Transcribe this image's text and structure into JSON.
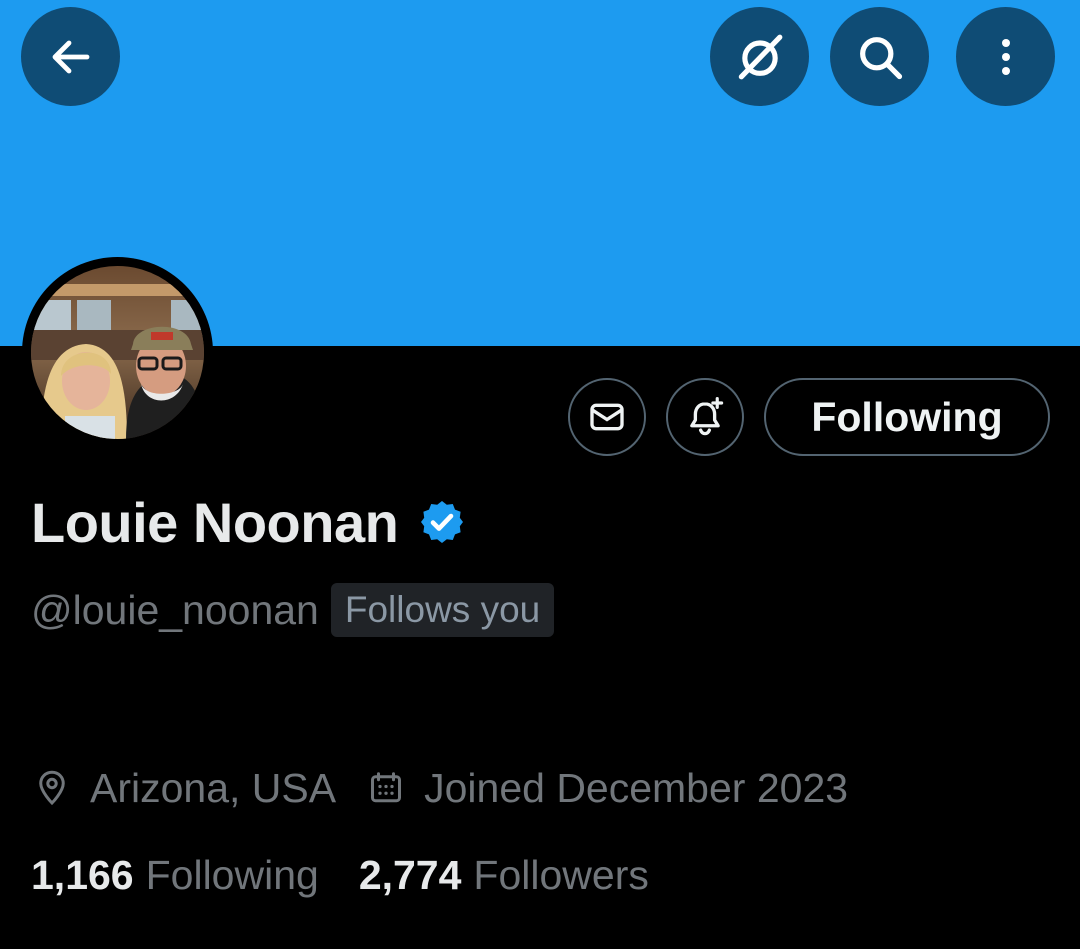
{
  "header": {
    "back_icon": "arrow-left-icon",
    "grok_icon": "grok-icon",
    "search_icon": "search-icon",
    "more_icon": "more-vertical-icon",
    "banner_color": "#1d9bf0"
  },
  "actions": {
    "message_icon": "mail-icon",
    "notify_icon": "bell-plus-icon",
    "follow_label": "Following"
  },
  "profile": {
    "display_name": "Louie Noonan",
    "verified": true,
    "verified_color": "#1d9bf0",
    "handle": "@louie_noonan",
    "follows_you": "Follows you",
    "location": "Arizona, USA",
    "joined": "Joined December 2023"
  },
  "stats": {
    "following_count": "1,166",
    "following_label": "Following",
    "followers_count": "2,774",
    "followers_label": "Followers"
  }
}
